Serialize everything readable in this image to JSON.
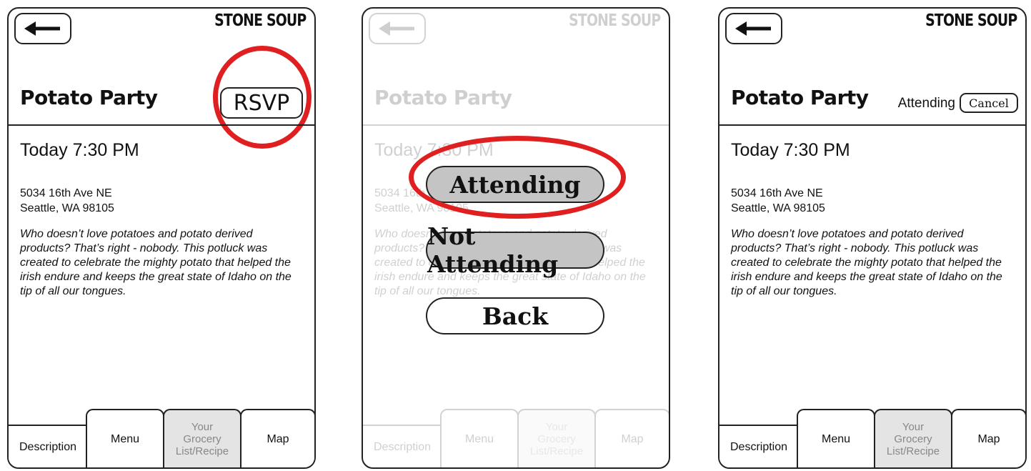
{
  "brand": "STONE SOUP",
  "event": {
    "title": "Potato Party",
    "datetime": "Today 7:30 PM",
    "address_line1": "5034 16th Ave NE",
    "address_line2": "Seattle, WA 98105",
    "description": "Who doesn’t love potatoes and potato derived products? That’s right - nobody. This potluck was created to celebrate the mighty potato that helped the irish endure and keeps the great state of Idaho on the tip of all our tongues."
  },
  "header": {
    "rsvp_label": "RSVP"
  },
  "rsvp_dialog": {
    "attending_label": "Attending",
    "not_attending_label": "Not Attending",
    "back_label": "Back"
  },
  "status": {
    "attending_text": "Attending",
    "cancel_label": "Cancel"
  },
  "tabs": {
    "description": "Description",
    "menu": "Menu",
    "grocery_line1": "Your",
    "grocery_line2": "Grocery",
    "grocery_line3": "List/Recipe",
    "map": "Map"
  },
  "colors": {
    "highlight": "#e02020",
    "option_fill": "#c4c4c4",
    "grocery_tab": "#e4e4e4"
  },
  "icons": {
    "back": "left-arrow-icon"
  }
}
